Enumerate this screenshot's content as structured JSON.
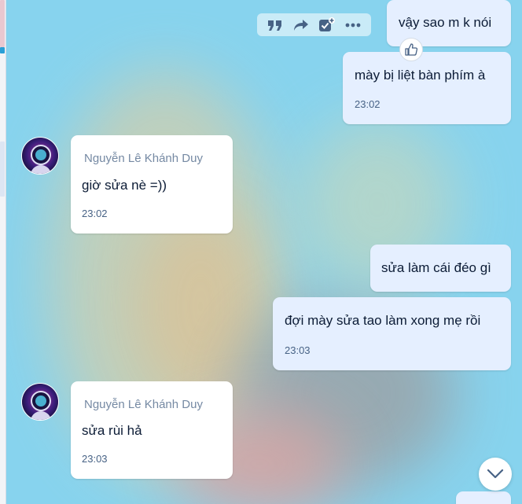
{
  "messages": [
    {
      "side": "me",
      "text": "vậy sao m k nói",
      "time": ""
    },
    {
      "side": "me",
      "text": "mày bị liệt bàn phím à",
      "time": "23:02"
    },
    {
      "side": "them",
      "sender": "Nguyễn Lê Khánh Duy",
      "text": "giờ sửa nè =))",
      "time": "23:02"
    },
    {
      "side": "me",
      "text": "sửa làm cái đéo gì",
      "time": ""
    },
    {
      "side": "me",
      "text": "đợi mày sửa tao làm xong mẹ rồi",
      "time": "23:03"
    },
    {
      "side": "them",
      "sender": "Nguyễn Lê Khánh Duy",
      "text": "sửa rùi hả",
      "time": "23:03"
    }
  ],
  "toolbar": {
    "icons": [
      "quote-icon",
      "forward-icon",
      "add-todo-icon",
      "more-icon"
    ]
  },
  "icons": {
    "like": "thumbs-up-icon",
    "scroll_down": "chevron-down-icon",
    "avatar": "astronaut-avatar"
  },
  "colors": {
    "my_bubble": "#e5efff",
    "their_bubble": "#ffffff",
    "sender_name": "#7589a3",
    "time": "#476285",
    "background": "#87d3ee"
  }
}
